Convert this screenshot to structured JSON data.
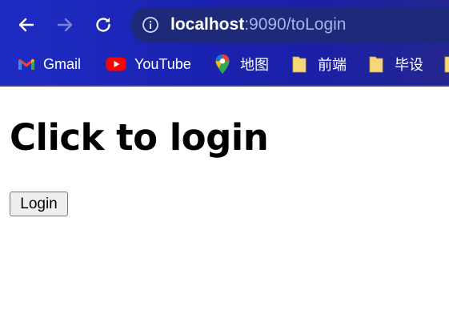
{
  "browser": {
    "address_bar": {
      "host": "localhost",
      "rest": ":9090/toLogin"
    },
    "bookmarks": [
      {
        "label": "Gmail",
        "icon": "gmail-icon"
      },
      {
        "label": "YouTube",
        "icon": "youtube-icon"
      },
      {
        "label": "地图",
        "icon": "maps-icon"
      },
      {
        "label": "前端",
        "icon": "folder-icon"
      },
      {
        "label": "毕设",
        "icon": "folder-icon"
      },
      {
        "label": "",
        "icon": "folder-icon"
      }
    ]
  },
  "page": {
    "heading": "Click to login",
    "button_label": "Login"
  },
  "colors": {
    "toolbar": "#1b22b0",
    "omnibox": "#1d2a7a",
    "folder": "#f5d77a",
    "youtube": "#ff0000"
  }
}
